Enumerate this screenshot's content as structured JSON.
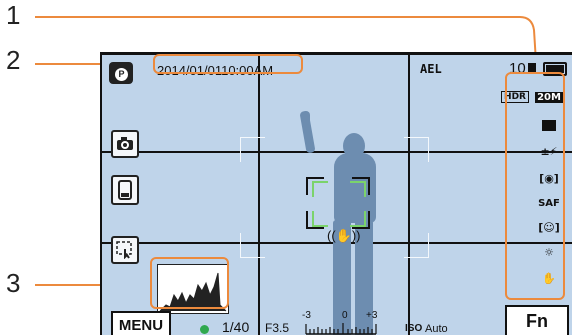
{
  "callouts": {
    "one": "1",
    "two": "2",
    "three": "3"
  },
  "hud": {
    "datetime": "2014/01/0110:00AM",
    "ael": "AEL",
    "shots_remaining": "10",
    "shutter": "1/40",
    "aperture": "F3.5",
    "ev_minus": "-3",
    "ev_zero": "0",
    "ev_plus": "+3",
    "iso": "Auto"
  },
  "buttons": {
    "menu": "MENU",
    "fn": "Fn"
  },
  "right_icons": [
    "HDR",
    "20M",
    "",
    "",
    "",
    "SAF",
    "",
    "",
    ""
  ],
  "colors": {
    "accent": "#ec8a3d",
    "screen_bg": "#bfd4ea",
    "focus": "#7bd36b"
  }
}
